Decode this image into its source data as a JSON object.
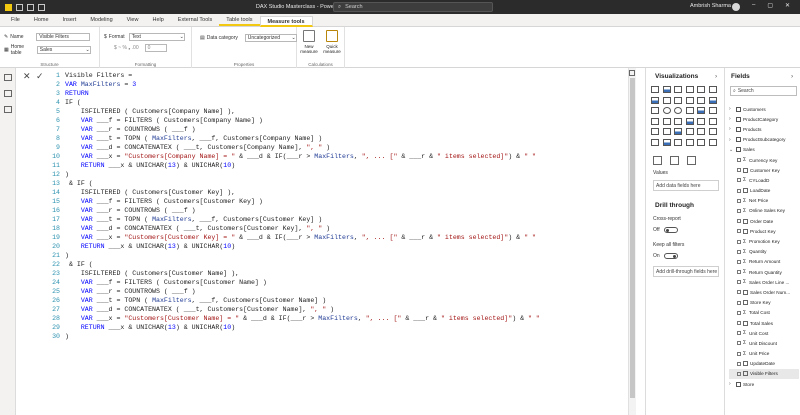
{
  "window": {
    "title": "DAX Studio Masterclass - Power BI Desktop",
    "search_placeholder": "Search",
    "user": "Ambrish Sharma"
  },
  "tabs": [
    "File",
    "Home",
    "Insert",
    "Modeling",
    "View",
    "Help",
    "External Tools",
    "Table tools",
    "Measure tools"
  ],
  "active_tab": "Measure tools",
  "ribbon": {
    "structure": {
      "name_label": "Name",
      "name_value": "Visible Filters",
      "home_table_label": "Home table",
      "home_table_value": "Sales",
      "group_label": "Structure"
    },
    "formatting": {
      "format_label": "Format",
      "format_value": "Text",
      "symbols": "$ ~ % ❟ .00",
      "zero": "0",
      "group_label": "Formatting"
    },
    "properties": {
      "data_category_label": "Data category",
      "data_category_value": "Uncategorized",
      "group_label": "Properties"
    },
    "calculations": {
      "new_measure": "New measure",
      "quick_measure": "Quick measure",
      "group_label": "Calculations"
    }
  },
  "formula": {
    "lines": [
      "Visible Filters =",
      "VAR MaxFilters = 3",
      "RETURN",
      "IF (",
      "    ISFILTERED ( Customers[Company Name] ),",
      "    VAR ___f = FILTERS ( Customers[Company Name] )",
      "    VAR ___r = COUNTROWS ( ___f )",
      "    VAR ___t = TOPN ( MaxFilters, ___f, Customers[Company Name] )",
      "    VAR ___d = CONCATENATEX ( ___t, Customers[Company Name], \", \" )",
      "    VAR ___x = \"Customers[Company Name] = \" & ___d & IF(___r > MaxFilters, \", ... [\" & ___r & \" items selected]\") & \" \"",
      "    RETURN ___x & UNICHAR(13) & UNICHAR(10)",
      ")",
      " & IF (",
      "    ISFILTERED ( Customers[Customer Key] ),",
      "    VAR ___f = FILTERS ( Customers[Customer Key] )",
      "    VAR ___r = COUNTROWS ( ___f )",
      "    VAR ___t = TOPN ( MaxFilters, ___f, Customers[Customer Key] )",
      "    VAR ___d = CONCATENATEX ( ___t, Customers[Customer Key], \", \" )",
      "    VAR ___x = \"Customers[Customer Key] = \" & ___d & IF(___r > MaxFilters, \", ... [\" & ___r & \" items selected]\") & \" \"",
      "    RETURN ___x & UNICHAR(13) & UNICHAR(10)",
      ")",
      " & IF (",
      "    ISFILTERED ( Customers[Customer Name] ),",
      "    VAR ___f = FILTERS ( Customers[Customer Name] )",
      "    VAR ___r = COUNTROWS ( ___f )",
      "    VAR ___t = TOPN ( MaxFilters, ___f, Customers[Customer Name] )",
      "    VAR ___d = CONCATENATEX ( ___t, Customers[Customer Name], \", \" )",
      "    VAR ___x = \"Customers[Customer Name] = \" & ___d & IF(___r > MaxFilters, \", ... [\" & ___r & \" items selected]\") & \" \"",
      "    RETURN ___x & UNICHAR(13) & UNICHAR(10)",
      ")"
    ]
  },
  "visualizations": {
    "title": "Visualizations",
    "values_label": "Values",
    "values_placeholder": "Add data fields here",
    "drill_title": "Drill through",
    "cross_report_label": "Cross-report",
    "cross_report_state": "Off",
    "keep_filters_label": "Keep all filters",
    "keep_filters_state": "On",
    "drill_placeholder": "Add drill-through fields here"
  },
  "fields": {
    "title": "Fields",
    "search_placeholder": "Search",
    "tables": [
      "Customers",
      "ProductCategory",
      "Products",
      "ProductSubcategory"
    ],
    "sales_table": "Sales",
    "sales_fields": [
      {
        "name": "Currency Key",
        "sigma": true
      },
      {
        "name": "Customer Key",
        "sigma": false
      },
      {
        "name": "CYLoadD",
        "sigma": true
      },
      {
        "name": "LoadDate",
        "sigma": false
      },
      {
        "name": "Net Price",
        "sigma": true
      },
      {
        "name": "Online Sales Key",
        "sigma": true
      },
      {
        "name": "Order Date",
        "sigma": false
      },
      {
        "name": "Product Key",
        "sigma": false
      },
      {
        "name": "Promotion Key",
        "sigma": true
      },
      {
        "name": "Quantity",
        "sigma": true
      },
      {
        "name": "Return Amount",
        "sigma": true
      },
      {
        "name": "Return Quantity",
        "sigma": true
      },
      {
        "name": "Sales Order Line ...",
        "sigma": true
      },
      {
        "name": "Sales Order Num...",
        "sigma": false
      },
      {
        "name": "Store Key",
        "sigma": false
      },
      {
        "name": "Total Cost",
        "sigma": true
      },
      {
        "name": "Total Sales",
        "sigma": false
      },
      {
        "name": "Unit Cost",
        "sigma": true
      },
      {
        "name": "Unit Discount",
        "sigma": true
      },
      {
        "name": "Unit Price",
        "sigma": true
      },
      {
        "name": "UpdateDate",
        "sigma": false
      },
      {
        "name": "Visible Filters",
        "sigma": false
      }
    ],
    "last_table": "Store"
  },
  "colors": {
    "accent": "#f2c811",
    "keyword": "#0000ff",
    "string": "#a31515",
    "line_number": "#2b91af"
  }
}
